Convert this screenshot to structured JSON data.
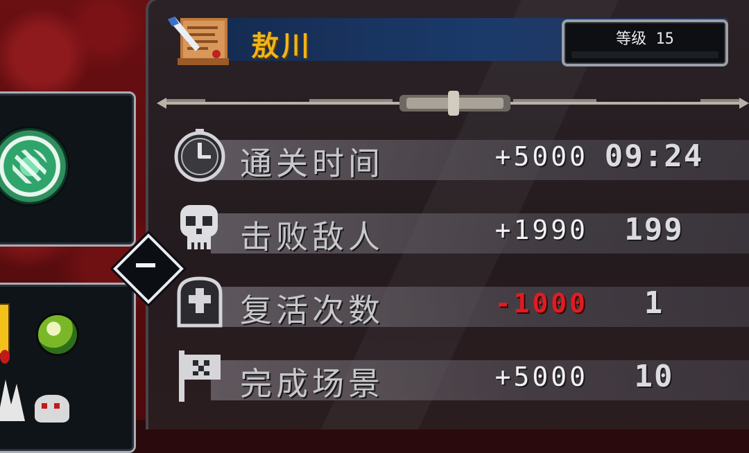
{
  "header": {
    "player_name": "敖川",
    "level_label": "等级 15"
  },
  "stats": [
    {
      "label": "通关时间",
      "points": "+5000",
      "value": "09:24",
      "icon": "clock-icon",
      "negative": false
    },
    {
      "label": "击败敌人",
      "points": "+1990",
      "value": "199",
      "icon": "skull-icon",
      "negative": false
    },
    {
      "label": "复活次数",
      "points": "-1000",
      "value": "1",
      "icon": "tombstone-icon",
      "negative": true
    },
    {
      "label": "完成场景",
      "points": "+5000",
      "value": "10",
      "icon": "flag-icon",
      "negative": false
    }
  ],
  "colors": {
    "name": "#f0b419",
    "negative": "#e01c22",
    "header_bar": "#1b3a6a"
  }
}
